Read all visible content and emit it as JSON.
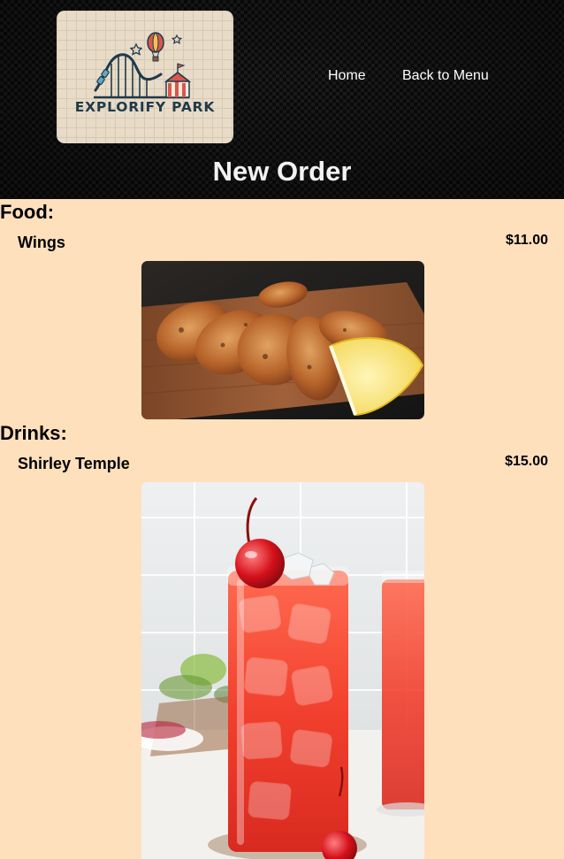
{
  "header": {
    "logo": {
      "text": "EXPLORIFY PARK",
      "icon": "amusement-park-logo-icon"
    },
    "nav": {
      "home_label": "Home",
      "back_label": "Back to Menu"
    },
    "title": "New Order"
  },
  "sections": {
    "food": {
      "heading": "Food:",
      "item": {
        "name": "Wings",
        "price": "$11.00",
        "image_icon": "chicken-wings-photo"
      }
    },
    "drinks": {
      "heading": "Drinks:",
      "item": {
        "name": "Shirley Temple",
        "price": "$15.00",
        "image_icon": "shirley-temple-drink-photo"
      }
    }
  },
  "colors": {
    "page_background": "#ffe0bd",
    "header_background": "#0b0b0b",
    "logo_background": "#e8dcc8",
    "logo_text": "#1f3a4a",
    "nav_text": "#ffffff"
  }
}
